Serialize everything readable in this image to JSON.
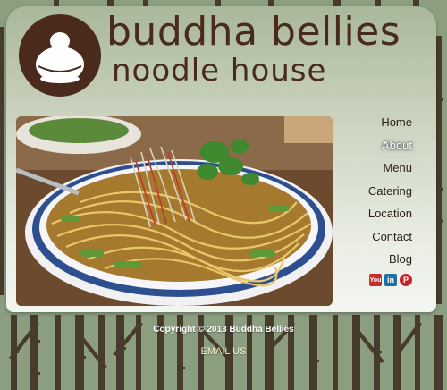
{
  "brand": {
    "line1": "buddha bellies",
    "line2": "noodle house",
    "logo_icon": "buddha-logo-icon",
    "color": "#4a2a1c"
  },
  "nav": {
    "items": [
      {
        "label": "Home"
      },
      {
        "label": "About"
      },
      {
        "label": "Menu"
      },
      {
        "label": "Catering"
      },
      {
        "label": "Location"
      },
      {
        "label": "Contact"
      },
      {
        "label": "Blog"
      }
    ],
    "active": "About"
  },
  "social": [
    {
      "name": "youtube-icon",
      "glyph": "You"
    },
    {
      "name": "linkedin-icon",
      "glyph": "in"
    },
    {
      "name": "pinterest-icon",
      "glyph": "P"
    }
  ],
  "footer": {
    "copyright": "Copyright © 2013 Buddha Bellies",
    "email_label": "EMAIL US"
  },
  "colors": {
    "background": "#8c9e80",
    "bamboo": "#3b2a20",
    "card_top": "#a9b79b",
    "card_bottom": "#f4f6f1"
  }
}
